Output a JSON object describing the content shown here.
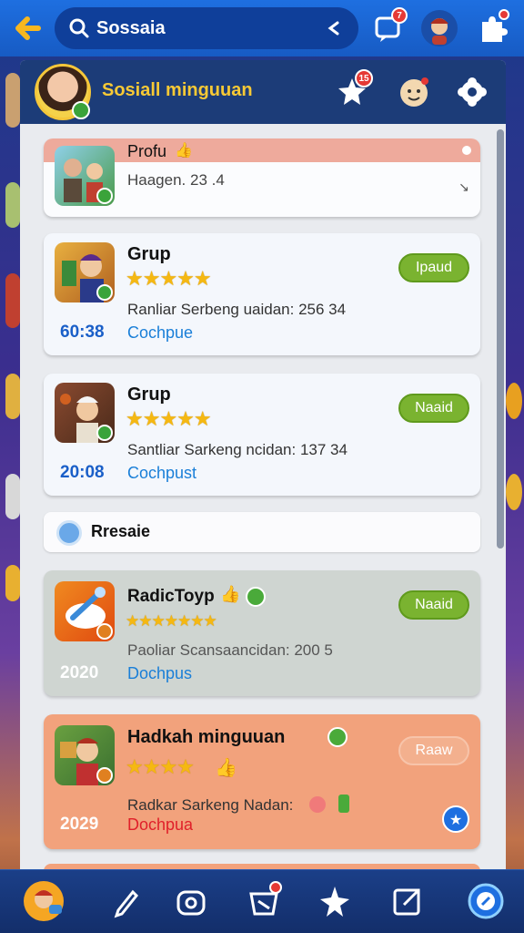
{
  "top_bar": {
    "search_text": "Sossaia",
    "chat_badge": "7"
  },
  "panel": {
    "title": "Sosiall minguuan",
    "star_badge": "15"
  },
  "cards": [
    {
      "title": "Profu",
      "subtitle": "Haagen. 23 .4"
    },
    {
      "title": "Grup",
      "stars": "★★★★★",
      "line": "Ranliar Serbeng uaidan: 256 34",
      "time": "60:38",
      "link": "Cochpue",
      "button": "Ipaud"
    },
    {
      "title": "Grup",
      "stars": "★★★★★",
      "line": "Santliar Sarkeng ncidan: 137 34",
      "time": "20:08",
      "link": "Cochpust",
      "button": "Naaid"
    },
    {
      "title": "RadicToyp",
      "stars": "★★★★★★★",
      "line": "Paoliar Scansaancidan: 200 5",
      "time": "2020",
      "link": "Dochpus",
      "button": "Naaid"
    },
    {
      "title": "Hadkah minguuan",
      "stars": "★★★★",
      "line": "Radkar Sarkeng Nadan:",
      "time": "2029",
      "link": "Dochpua",
      "button": "Raaw"
    }
  ],
  "section": {
    "label": "Rresaie"
  },
  "colors": {
    "accent_blue": "#1e6fe0",
    "header_navy": "#1c3c78",
    "title_yellow": "#f7c935",
    "green_button": "#7ab330",
    "orange_card": "#f2a27c",
    "grey_card": "#cfd5d1"
  }
}
